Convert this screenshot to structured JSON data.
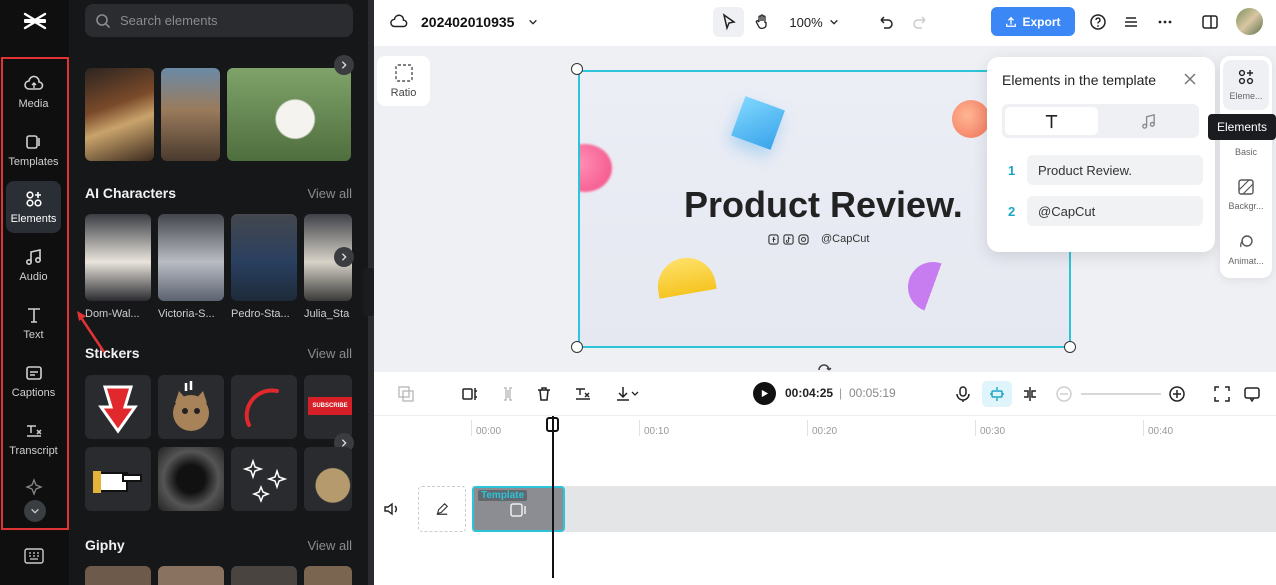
{
  "rail": {
    "items": [
      {
        "label": "Media",
        "icon": "media-icon"
      },
      {
        "label": "Templates",
        "icon": "templates-icon"
      },
      {
        "label": "Elements",
        "icon": "elements-icon"
      },
      {
        "label": "Audio",
        "icon": "audio-icon"
      },
      {
        "label": "Text",
        "icon": "text-icon"
      },
      {
        "label": "Captions",
        "icon": "captions-icon"
      },
      {
        "label": "Transcript",
        "icon": "transcript-icon"
      }
    ],
    "active": "Elements",
    "highlight_color": "#e03434"
  },
  "panel": {
    "search_placeholder": "Search elements",
    "sections": [
      {
        "title": "AI Characters",
        "view_all": "View all",
        "items": [
          "Dom-Wal...",
          "Victoria-S...",
          "Pedro-Sta...",
          "Julia_Sta"
        ]
      },
      {
        "title": "Stickers",
        "view_all": "View all",
        "items": [
          "SUBSCRIBE"
        ]
      },
      {
        "title": "Giphy",
        "view_all": "View all"
      }
    ]
  },
  "topbar": {
    "project_name": "202402010935",
    "zoom": "100%",
    "export_label": "Export",
    "accent": "#3b87f6"
  },
  "canvas": {
    "ratio_label": "Ratio",
    "headline": "Product Review.",
    "handle": "@CapCut",
    "frame_color": "#2cc4d8"
  },
  "popup": {
    "title": "Elements in the template",
    "rows": [
      {
        "num": "1",
        "value": "Product Review."
      },
      {
        "num": "2",
        "value": "@CapCut"
      }
    ]
  },
  "right_panel": {
    "items": [
      "Eleme...",
      "Basic",
      "Backgr...",
      "Animat..."
    ],
    "tooltip": "Elements"
  },
  "controls": {
    "current_time": "00:04:25",
    "separator": "|",
    "total_time": "00:05:19"
  },
  "timeline": {
    "ticks": [
      "00:00",
      "00:10",
      "00:20",
      "00:30",
      "00:40"
    ],
    "clip_label": "Template"
  }
}
